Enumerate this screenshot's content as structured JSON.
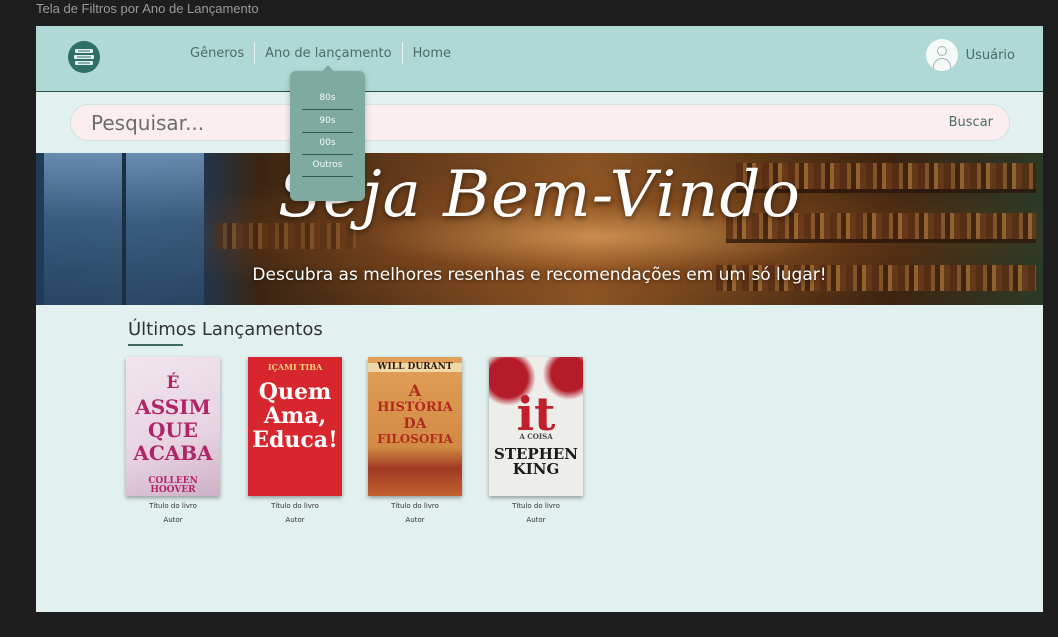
{
  "canvas_label": "Tela de Filtros por Ano de Lançamento",
  "nav": {
    "links": [
      "Gêneros",
      "Ano de lançamento",
      "Home"
    ],
    "user_label": "Usuário",
    "logo_icon": "book-stack-logo-icon"
  },
  "search": {
    "placeholder": "Pesquisar...",
    "button_label": "Buscar"
  },
  "dropdown": {
    "items": [
      "80s",
      "90s",
      "00s",
      "Outros"
    ]
  },
  "hero": {
    "title": "Seja Bem-Vindo",
    "subtitle": "Descubra as melhores resenhas e recomendações em um só lugar!"
  },
  "section": {
    "title": "Últimos Lançamentos"
  },
  "books": [
    {
      "cover_lines": [
        "É",
        "ASSIM",
        "QUE",
        "ACABA"
      ],
      "cover_author": "COLLEEN HOOVER",
      "title": "Título do livro",
      "author": "Autor"
    },
    {
      "cover_lines": [
        "Quem",
        "Ama,",
        "Educa!"
      ],
      "cover_author": "IÇAMI TIBA",
      "title": "Título do livro",
      "author": "Autor"
    },
    {
      "cover_lines": [
        "A",
        "HISTÓRIA",
        "DA",
        "FILOSOFIA"
      ],
      "cover_author": "WILL DURANT",
      "title": "Título do livro",
      "author": "Autor"
    },
    {
      "cover_lines": [
        "A COISA",
        "it"
      ],
      "cover_author": "STEPHEN KING",
      "title": "Título do livro",
      "author": "Autor"
    }
  ],
  "colors": {
    "navbar": "#b0d9d5",
    "page_bg": "#e2f0ef",
    "search_bg": "#fbeeee",
    "dropdown_bg": "#7faa9f",
    "accent": "#3d6b63"
  }
}
